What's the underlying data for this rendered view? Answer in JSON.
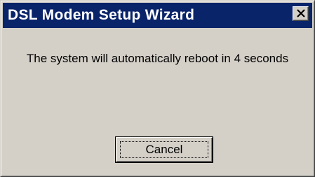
{
  "window": {
    "title": "DSL Modem Setup Wizard",
    "close_icon": "close-x-icon"
  },
  "dialog": {
    "message": "The system will automatically reboot in 4 seconds",
    "cancel_label": "Cancel"
  },
  "colors": {
    "titlebar": "#0a246a",
    "title_text": "#ffffff",
    "face": "#d4d0c8"
  }
}
